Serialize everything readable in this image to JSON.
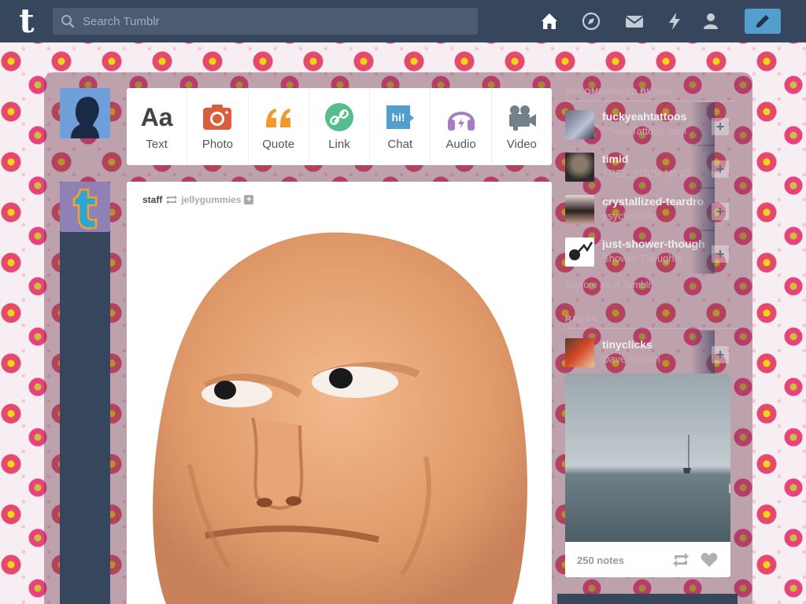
{
  "header": {
    "logo_letter": "t",
    "search": {
      "placeholder": "Search Tumblr"
    },
    "nav_icons": [
      "home-icon",
      "explore-compass-icon",
      "inbox-mail-icon",
      "activity-lightning-icon",
      "account-person-icon"
    ],
    "compose_icon": "pencil-icon"
  },
  "post_types": [
    {
      "label": "Text",
      "icon": "text-aa-icon",
      "glyph": "Aa",
      "color": "#444444"
    },
    {
      "label": "Photo",
      "icon": "camera-icon",
      "color": "#d95e40"
    },
    {
      "label": "Quote",
      "icon": "quote-icon",
      "glyph": "66",
      "color": "#f2992e"
    },
    {
      "label": "Link",
      "icon": "link-icon",
      "color": "#56bc8a"
    },
    {
      "label": "Chat",
      "icon": "chat-bubble-icon",
      "glyph": "hi!",
      "color": "#529ecc"
    },
    {
      "label": "Audio",
      "icon": "headphones-icon",
      "color": "#a77dc2"
    },
    {
      "label": "Video",
      "icon": "video-camera-icon",
      "color": "#748089"
    }
  ],
  "post": {
    "author": "staff",
    "reblogged_from": "jellygummies"
  },
  "sidebar": {
    "recommended_title": "RECOMMENDED BLOGS",
    "recommended": [
      {
        "name": "fuckyeahtattoos",
        "subtitle": "FYeahTattoos.com"
      },
      {
        "name": "timid",
        "subtitle": "FREE YOUR MIND"
      },
      {
        "name": "crystallized-teardrops",
        "subtitle": "psychedelic"
      },
      {
        "name": "just-shower-thoughts",
        "subtitle": "Shower Thoughts"
      }
    ],
    "explore_link": "Explore all of Tumblr",
    "radar_title": "RADAR",
    "radar": {
      "blog": {
        "name": "tinyclicks",
        "subtitle": "Dave Gorum"
      },
      "notes": "250 notes"
    }
  },
  "colors": {
    "topbar": "#36465d",
    "accent": "#529ecc"
  }
}
